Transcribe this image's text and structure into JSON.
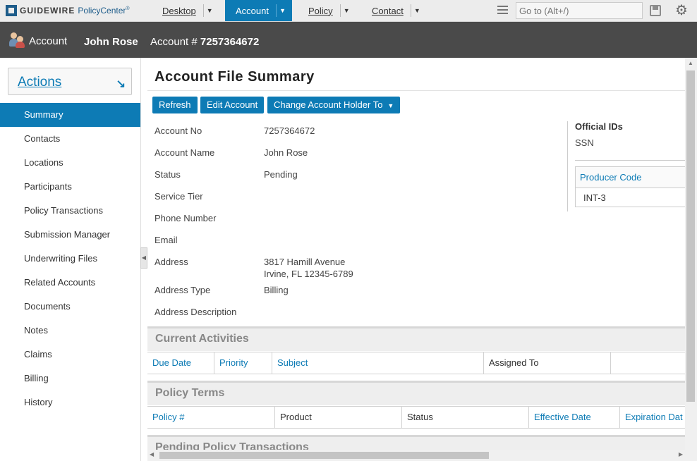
{
  "app": {
    "brand": "GUIDEWIRE",
    "product": "PolicyCenter",
    "trademark": "®"
  },
  "topnav": {
    "tabs": [
      {
        "label": "Desktop"
      },
      {
        "label": "Account"
      },
      {
        "label": "Policy"
      },
      {
        "label": "Contact"
      }
    ],
    "goto_placeholder": "Go to (Alt+/)",
    "dropdown_glyph": "▼"
  },
  "infobar": {
    "section": "Account",
    "holder_name": "John Rose",
    "account_label": "Account #",
    "account_number": "7257364672"
  },
  "sidebar": {
    "actions_label": "Actions",
    "actions_glyph": "↘",
    "items": [
      {
        "label": "Summary",
        "active": true
      },
      {
        "label": "Contacts"
      },
      {
        "label": "Locations"
      },
      {
        "label": "Participants"
      },
      {
        "label": "Policy Transactions"
      },
      {
        "label": "Submission Manager"
      },
      {
        "label": "Underwriting Files"
      },
      {
        "label": "Related Accounts"
      },
      {
        "label": "Documents"
      },
      {
        "label": "Notes"
      },
      {
        "label": "Claims"
      },
      {
        "label": "Billing"
      },
      {
        "label": "History"
      }
    ]
  },
  "main": {
    "title": "Account File Summary",
    "buttons": {
      "refresh": "Refresh",
      "edit_account": "Edit Account",
      "change_holder": "Change Account Holder To"
    },
    "fields": [
      {
        "label": "Account No",
        "value": "7257364672"
      },
      {
        "label": "Account Name",
        "value": "John Rose"
      },
      {
        "label": "Status",
        "value": "Pending"
      },
      {
        "label": "Service Tier",
        "value": ""
      },
      {
        "label": "Phone Number",
        "value": ""
      },
      {
        "label": "Email",
        "value": ""
      },
      {
        "label": "Address",
        "value": "3817 Hamill Avenue",
        "value2": "Irvine, FL 12345-6789"
      },
      {
        "label": "Address Type",
        "value": "Billing"
      },
      {
        "label": "Address Description",
        "value": ""
      }
    ],
    "official_ids": {
      "title": "Official IDs",
      "ssn_label": "SSN",
      "producer_code_header": "Producer Code",
      "producer_code": "INT-3"
    },
    "current_activities": {
      "title": "Current Activities",
      "columns": [
        "Due Date",
        "Priority",
        "Subject",
        "Assigned To"
      ]
    },
    "policy_terms": {
      "title": "Policy Terms",
      "columns": [
        "Policy #",
        "Product",
        "Status",
        "Effective Date",
        "Expiration Dat"
      ]
    },
    "pending_transactions": {
      "title": "Pending Policy Transactions"
    }
  },
  "colors": {
    "accent": "#0d7bb5",
    "header_bar": "#4a4a4a",
    "nav_bg": "#ececec"
  }
}
